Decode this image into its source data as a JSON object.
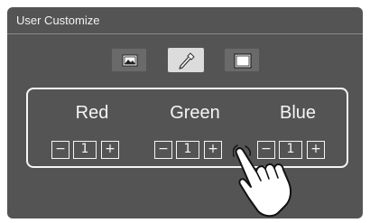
{
  "window": {
    "title": "User Customize"
  },
  "tabs": [
    {
      "icon": "image-icon",
      "active": false
    },
    {
      "icon": "eyedropper-icon",
      "active": true
    },
    {
      "icon": "panel-icon",
      "active": false
    }
  ],
  "colors": {
    "red": {
      "label": "Red",
      "value": "1",
      "minus": "−",
      "plus": "+"
    },
    "green": {
      "label": "Green",
      "value": "1",
      "minus": "−",
      "plus": "+"
    },
    "blue": {
      "label": "Blue",
      "value": "1",
      "minus": "−",
      "plus": "+"
    }
  },
  "theme": {
    "screen": "#545454",
    "foreground": "#f5f5f5",
    "active_tab": "#dcdcdc"
  }
}
